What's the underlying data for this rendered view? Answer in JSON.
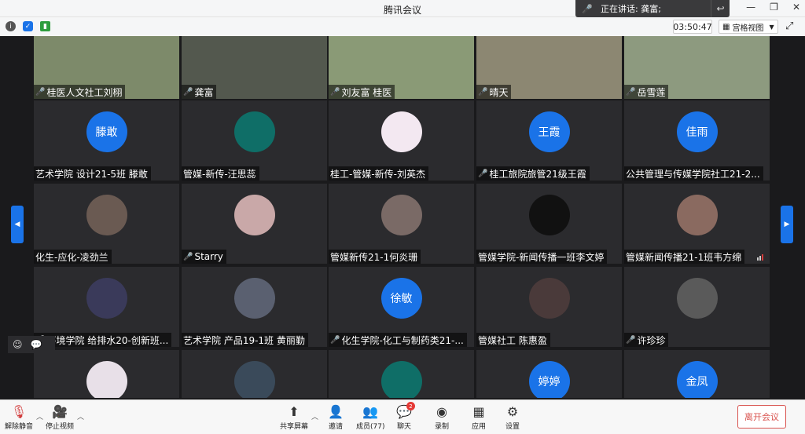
{
  "window": {
    "title": "腾讯会议",
    "speaking": "正在讲话: 龚富;"
  },
  "infobar": {
    "timer": "03:50:47",
    "view_label": "宫格视图"
  },
  "video_tiles": [
    {
      "name": "桂医人文社工刘栩"
    },
    {
      "name": "龚富"
    },
    {
      "name": "刘友富 桂医"
    },
    {
      "name": "晴天"
    },
    {
      "name": "岳雪莲"
    }
  ],
  "tiles": [
    {
      "avatar": "滕敢",
      "name": "艺术学院 设计21-5班 滕敢",
      "muted": false
    },
    {
      "avatar": "",
      "name": "管媒-新传-汪思蕊",
      "muted": false
    },
    {
      "avatar": "",
      "name": "桂工-管媒-新传-刘英杰",
      "muted": false
    },
    {
      "avatar": "王霞",
      "name": "桂工旅院旅管21级王霞",
      "muted": true
    },
    {
      "avatar": "佳雨",
      "name": "公共管理与传媒学院社工21-2...",
      "muted": false
    },
    {
      "avatar": "",
      "name": "化生-应化-凌劲兰",
      "muted": false
    },
    {
      "avatar": "",
      "name": "Starry",
      "muted": true
    },
    {
      "avatar": "",
      "name": "管媒新传21-1何炎珊",
      "muted": false
    },
    {
      "avatar": "",
      "name": "管媒学院-新闻传播一班李文婷",
      "muted": false
    },
    {
      "avatar": "",
      "name": "管媒新闻传播21-1班韦方绵",
      "muted": false
    },
    {
      "avatar": "",
      "name": "环境学院 给排水20-创新班...",
      "muted": true
    },
    {
      "avatar": "",
      "name": "艺术学院 产品19-1班 黄丽勤",
      "muted": false
    },
    {
      "avatar": "徐敏",
      "name": "化生学院-化工与制药类21-...",
      "muted": true
    },
    {
      "avatar": "",
      "name": "管媒社工 陈惠盈",
      "muted": false
    },
    {
      "avatar": "",
      "name": "许珍珍",
      "muted": true
    },
    {
      "avatar": "",
      "name": "",
      "muted": false
    },
    {
      "avatar": "",
      "name": "",
      "muted": false
    },
    {
      "avatar": "",
      "name": "",
      "muted": false
    },
    {
      "avatar": "婷婷",
      "name": "",
      "muted": false
    },
    {
      "avatar": "金凤",
      "name": "",
      "muted": false
    }
  ],
  "toolbar": {
    "unmute": "解除静音",
    "stop_video": "停止视频",
    "share": "共享屏幕",
    "invite": "邀请",
    "members": "成员(77)",
    "chat": "聊天",
    "chat_badge": "2",
    "record": "录制",
    "apps": "应用",
    "settings": "设置",
    "leave": "离开会议"
  },
  "colors": {
    "accent": "#1a73e8",
    "danger": "#d9534f"
  }
}
